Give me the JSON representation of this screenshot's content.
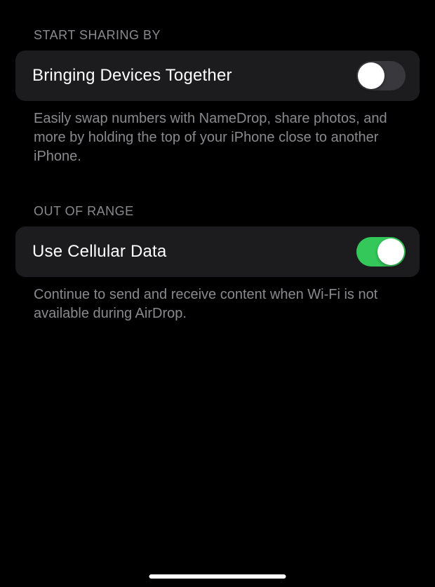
{
  "sections": [
    {
      "header": "START SHARING BY",
      "row_label": "Bringing Devices Together",
      "toggle_on": false,
      "footer": "Easily swap numbers with NameDrop, share photos, and more by holding the top of your iPhone close to another iPhone."
    },
    {
      "header": "OUT OF RANGE",
      "row_label": "Use Cellular Data",
      "toggle_on": true,
      "footer": "Continue to send and receive content when Wi-Fi is not available during AirDrop."
    }
  ],
  "colors": {
    "toggle_on": "#34c759",
    "toggle_off": "#39393d",
    "cell_bg": "#1c1c1e"
  }
}
